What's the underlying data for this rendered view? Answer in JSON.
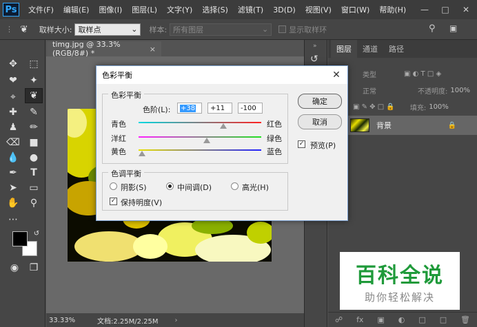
{
  "app": {
    "logo": "Ps",
    "menu": [
      "文件(F)",
      "编辑(E)",
      "图像(I)",
      "图层(L)",
      "文字(Y)",
      "选择(S)",
      "滤镜(T)",
      "3D(D)",
      "视图(V)",
      "窗口(W)",
      "帮助(H)"
    ]
  },
  "options": {
    "sample_size_label": "取样大小:",
    "sample_size_value": "取样点",
    "sample_label": "样本:",
    "sample_value": "所有图层",
    "show_ring_label": "显示取样环"
  },
  "document": {
    "tab_title": "timg.jpg @ 33.3%(RGB/8#) *",
    "close": "×",
    "zoom": "33.33%",
    "doc_info": "文档:2.25M/2.25M"
  },
  "layers": {
    "tabs": [
      "图层",
      "通道",
      "路径"
    ],
    "kind_placeholder": "类型",
    "blend_mode": "正常",
    "opacity_label": "不透明度:",
    "opacity_value": "100%",
    "lock_label": "锁定:",
    "fill_label": "填充:",
    "fill_value": "100%",
    "layer_name": "背景"
  },
  "dialog": {
    "title": "色彩平衡",
    "close": "✕",
    "group1_title": "色彩平衡",
    "levels_label": "色阶(L):",
    "level1": "+38",
    "level2": "+11",
    "level3": "-100",
    "slider1_left": "青色",
    "slider1_right": "红色",
    "slider2_left": "洋红",
    "slider2_right": "绿色",
    "slider3_left": "黄色",
    "slider3_right": "蓝色",
    "group2_title": "色调平衡",
    "shadows": "阴影(S)",
    "midtones": "中间调(D)",
    "highlights": "高光(H)",
    "preserve_luminosity": "保持明度(V)",
    "ok": "确定",
    "cancel": "取消",
    "preview": "预览(P)",
    "checkmark": "✓"
  },
  "watermark": {
    "title": "百科全说",
    "subtitle": "助你轻松解决"
  }
}
